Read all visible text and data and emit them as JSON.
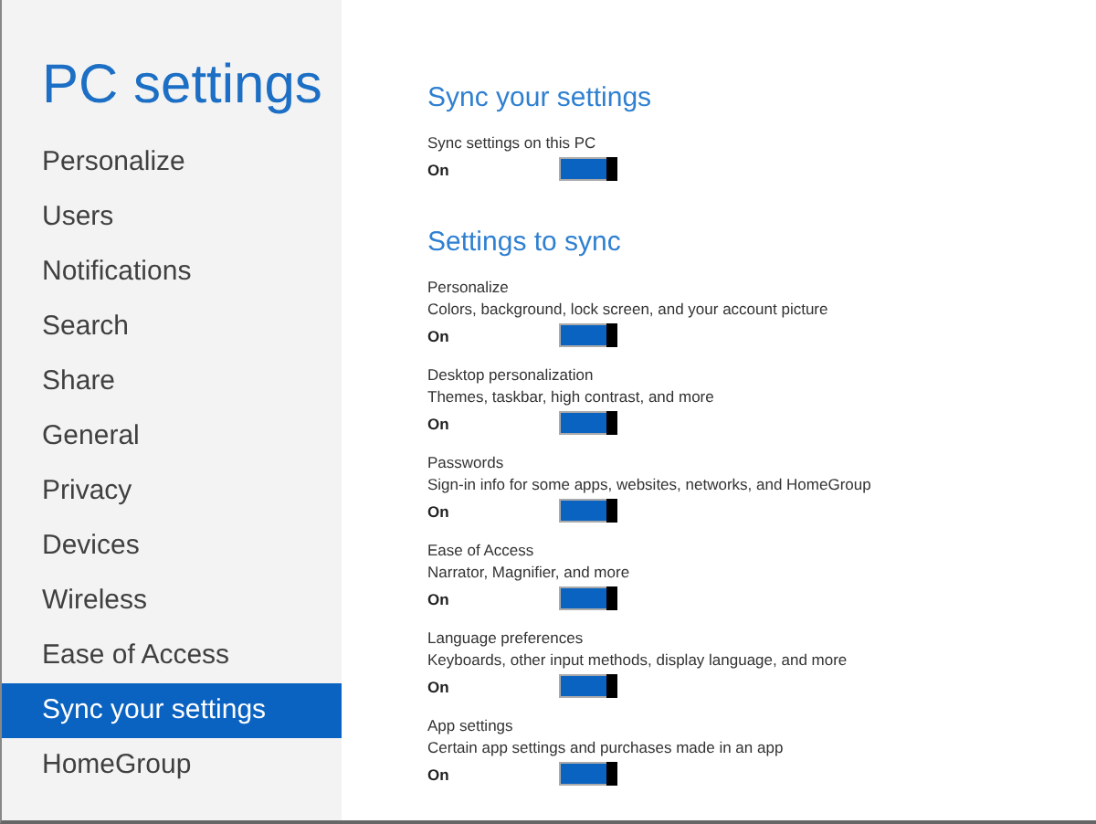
{
  "sidebar": {
    "title": "PC settings",
    "items": [
      {
        "label": "Personalize",
        "selected": false
      },
      {
        "label": "Users",
        "selected": false
      },
      {
        "label": "Notifications",
        "selected": false
      },
      {
        "label": "Search",
        "selected": false
      },
      {
        "label": "Share",
        "selected": false
      },
      {
        "label": "General",
        "selected": false
      },
      {
        "label": "Privacy",
        "selected": false
      },
      {
        "label": "Devices",
        "selected": false
      },
      {
        "label": "Wireless",
        "selected": false
      },
      {
        "label": "Ease of Access",
        "selected": false
      },
      {
        "label": "Sync your settings",
        "selected": true
      },
      {
        "label": "HomeGroup",
        "selected": false
      }
    ]
  },
  "sections": [
    {
      "heading": "Sync your settings",
      "settings": [
        {
          "label": "Sync settings on this PC",
          "state_text": "On",
          "on": true
        }
      ]
    },
    {
      "heading": "Settings to sync",
      "settings": [
        {
          "label": "Personalize",
          "description": "Colors, background, lock screen, and your account picture",
          "state_text": "On",
          "on": true
        },
        {
          "label": "Desktop personalization",
          "description": "Themes, taskbar, high contrast, and more",
          "state_text": "On",
          "on": true
        },
        {
          "label": "Passwords",
          "description": "Sign-in info for some apps, websites, networks, and HomeGroup",
          "state_text": "On",
          "on": true
        },
        {
          "label": "Ease of Access",
          "description": "Narrator, Magnifier, and more",
          "state_text": "On",
          "on": true
        },
        {
          "label": "Language preferences",
          "description": "Keyboards, other input methods, display language, and more",
          "state_text": "On",
          "on": true
        },
        {
          "label": "App settings",
          "description": "Certain app settings and purchases made in an app",
          "state_text": "On",
          "on": true
        }
      ]
    }
  ]
}
